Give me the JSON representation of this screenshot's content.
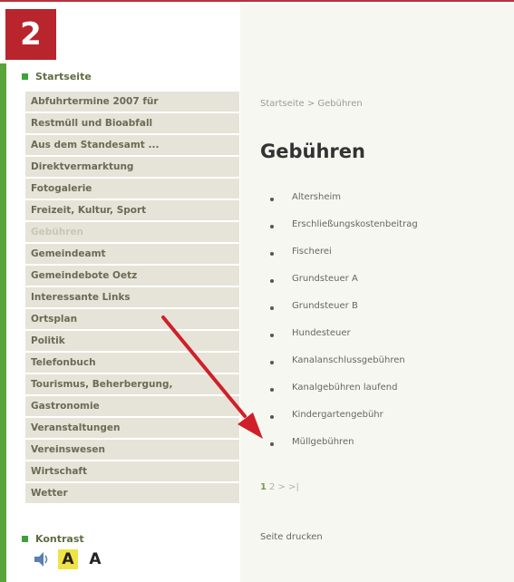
{
  "step_badge": "2",
  "sidebar": {
    "start_label": "Startseite",
    "items": [
      "Abfuhrtermine 2007 für",
      "Restmüll und Bioabfall",
      "Aus dem Standesamt ...",
      "Direktvermarktung",
      "Fotogalerie",
      "Freizeit, Kultur, Sport",
      "Gebühren",
      "Gemeindeamt",
      "Gemeindebote Oetz",
      "Interessante Links",
      "Ortsplan",
      "Politik",
      "Telefonbuch",
      "Tourismus, Beherbergung,",
      "Gastronomie",
      "Veranstaltungen",
      "Vereinswesen",
      "Wirtschaft",
      "Wetter"
    ],
    "kontrast_label": "Kontrast",
    "contrast_a_yellow": "A",
    "contrast_a_plain": "A"
  },
  "main": {
    "breadcrumb": "Startseite > Gebühren",
    "title": "Gebühren",
    "fees": [
      "Altersheim",
      "Erschließungskostenbeitrag",
      "Fischerei",
      "Grundsteuer A",
      "Grundsteuer B",
      "Hundesteuer",
      "Kanalanschlussgebühren",
      "Kanalgebühren laufend",
      "Kindergartengebühr",
      "Müllgebühren"
    ],
    "pager_current": "1",
    "pager_rest": "2 > >|",
    "print_label": "Seite drucken"
  },
  "colors": {
    "badge": "#b8252c",
    "green_bar": "#5aa53a",
    "arrow": "#d01f2a",
    "menu_bg": "#e6e4d8",
    "contrast_yellow": "#f1e246"
  }
}
